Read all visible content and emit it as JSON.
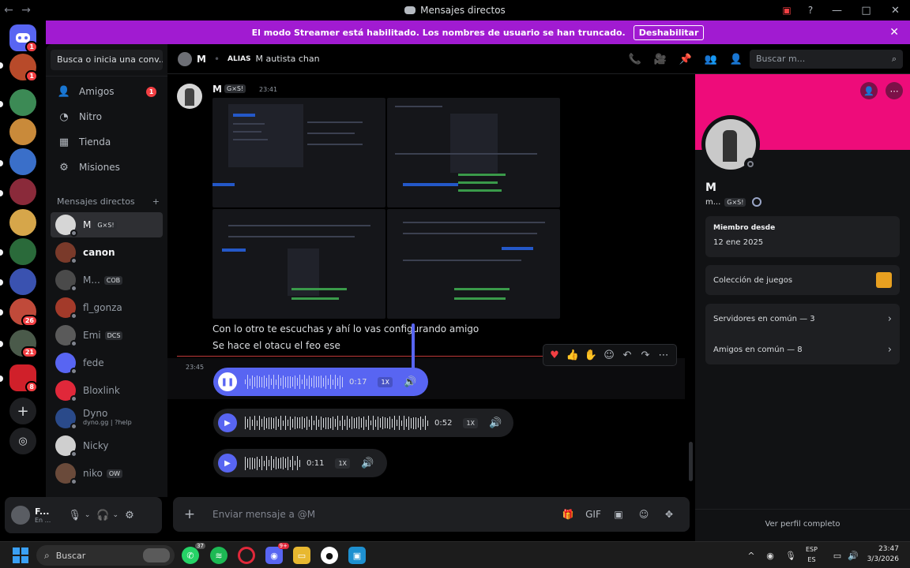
{
  "window": {
    "title": "Mensajes directos"
  },
  "banner": {
    "text": "El modo Streamer está habilitado. Los nombres de usuario se han truncado.",
    "button": "Deshabilitar"
  },
  "rail": {
    "badges": [
      "1",
      "1",
      "26",
      "21",
      "8"
    ]
  },
  "sidebar": {
    "search_placeholder": "Busca o inicia una conv...",
    "nav": [
      {
        "label": "Amigos",
        "count": "1"
      },
      {
        "label": "Nitro"
      },
      {
        "label": "Tienda"
      },
      {
        "label": "Misiones"
      }
    ],
    "dm_header": "Mensajes directos",
    "dms": [
      {
        "name": "M",
        "tag": "G×S!"
      },
      {
        "name": "canon"
      },
      {
        "name": "M...",
        "tag": "COB"
      },
      {
        "name": "fl_gonza"
      },
      {
        "name": "Emi",
        "tag": "DCS"
      },
      {
        "name": "fede"
      },
      {
        "name": "Bloxlink"
      },
      {
        "name": "Dyno",
        "sub": "dyno.gg | ?help"
      },
      {
        "name": "Nicky"
      },
      {
        "name": "niko",
        "tag": "OW"
      }
    ],
    "user": {
      "name": "F...",
      "status": "En ..."
    }
  },
  "header": {
    "name": "M",
    "alias_label": "ALIAS",
    "alias_value": "M autista chan",
    "search_placeholder": "Buscar m..."
  },
  "chat": {
    "author": "M",
    "author_tag": "G×S!",
    "time": "23:41",
    "line1": "Con lo otro te escuchas y ahí lo vas configurando amigo",
    "line2": "Se hace el otacu el feo ese",
    "voice_time": "23:45",
    "voice": [
      {
        "duration": "0:17",
        "speed": "1X",
        "playing": true
      },
      {
        "duration": "0:52",
        "speed": "1X",
        "playing": false
      },
      {
        "duration": "0:11",
        "speed": "1X",
        "playing": false
      }
    ],
    "composer_placeholder": "Enviar mensaje a @M"
  },
  "profile": {
    "name": "M",
    "username": "m...",
    "tag": "G×S!",
    "member_since_label": "Miembro desde",
    "member_since": "12 ene 2025",
    "games_label": "Colección de juegos",
    "servers": "Servidores en común — 3",
    "friends": "Amigos en común — 8",
    "full_profile": "Ver perfil completo"
  },
  "taskbar": {
    "search": "Buscar",
    "whatsapp_badge": "37",
    "discord_badge": "9+",
    "lang1": "ESP",
    "lang2": "ES",
    "time": "23:47",
    "date": "3/3/2026"
  },
  "colors": {
    "accent": "#5865f2",
    "banner": "#a11bd1",
    "profile_banner": "#ee0c7a",
    "danger": "#f23f43"
  }
}
